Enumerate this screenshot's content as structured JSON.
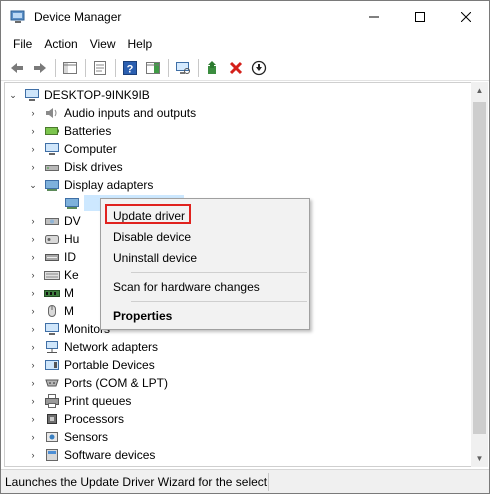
{
  "window": {
    "title": "Device Manager",
    "controls": {
      "minimize": "—",
      "maximize": "☐",
      "close": "✕"
    }
  },
  "menu": [
    "File",
    "Action",
    "View",
    "Help"
  ],
  "toolbar": {
    "buttons": [
      "back-icon",
      "forward-icon",
      "show-hide-console-tree-icon",
      "properties-icon",
      "help-icon",
      "action-pane-icon",
      "scan-hardware-icon",
      "update-driver-icon",
      "uninstall-icon",
      "download-icon"
    ]
  },
  "tree": {
    "root": "DESKTOP-9INK9IB",
    "items": [
      {
        "label": "Audio inputs and outputs",
        "icon": "speaker-icon"
      },
      {
        "label": "Batteries",
        "icon": "battery-icon"
      },
      {
        "label": "Computer",
        "icon": "monitor-icon"
      },
      {
        "label": "Disk drives",
        "icon": "disk-icon"
      },
      {
        "label": "Display adapters",
        "icon": "display-adapter-icon",
        "expanded": true
      },
      {
        "label": "",
        "icon": "display-adapter-icon",
        "child": true
      },
      {
        "label": "DV",
        "icon": "dvd-icon"
      },
      {
        "label": "Hu",
        "icon": "hid-icon"
      },
      {
        "label": "ID",
        "icon": "ide-icon"
      },
      {
        "label": "Ke",
        "icon": "keyboard-icon"
      },
      {
        "label": "M",
        "icon": "memory-icon"
      },
      {
        "label": "M",
        "icon": "mouse-icon"
      },
      {
        "label": "Monitors",
        "icon": "monitor-icon"
      },
      {
        "label": "Network adapters",
        "icon": "network-icon"
      },
      {
        "label": "Portable Devices",
        "icon": "portable-device-icon"
      },
      {
        "label": "Ports (COM & LPT)",
        "icon": "port-icon"
      },
      {
        "label": "Print queues",
        "icon": "printer-icon"
      },
      {
        "label": "Processors",
        "icon": "processor-icon"
      },
      {
        "label": "Sensors",
        "icon": "sensor-icon"
      },
      {
        "label": "Software devices",
        "icon": "software-device-icon"
      }
    ]
  },
  "context_menu": {
    "items": [
      "Update driver",
      "Disable device",
      "Uninstall device",
      "Scan for hardware changes",
      "Properties"
    ],
    "highlighted": "Update driver",
    "highlight_color": "#e0221e"
  },
  "status": {
    "text": "Launches the Update Driver Wizard for the selecte"
  }
}
